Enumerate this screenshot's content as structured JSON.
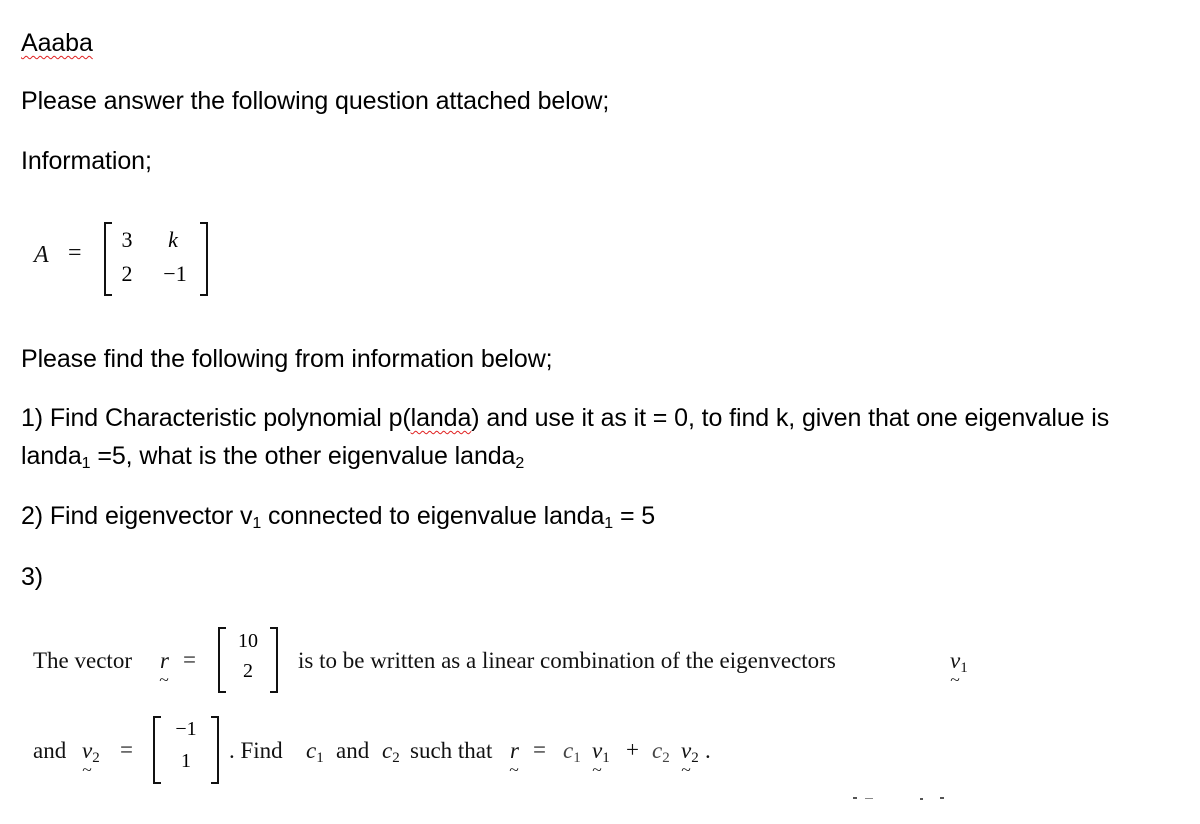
{
  "document": {
    "title": "Aaaba",
    "intro": "Please answer the following question attached below;",
    "information_label": "Information;",
    "matrix_A": {
      "name": "A",
      "equals": "=",
      "rows": [
        [
          "3",
          "k"
        ],
        [
          "2",
          "−1"
        ]
      ]
    },
    "find_label": "Please find the following from information below;",
    "q1": {
      "prefix": "1) Find Characteristic polynomial p(",
      "misspelled": "landa",
      "suffix": ") and use it as it = 0, to find k, given that one eigenvalue is",
      "line2_a": "landa",
      "line2_sub1": "1",
      "line2_b": " =5, what is the other eigenvalue landa",
      "line2_sub2": "2"
    },
    "q2": {
      "a": "2) Find eigenvector v",
      "sub1": "1",
      "b": " connected to eigenvalue landa",
      "sub2": "1",
      "c": " = 5"
    },
    "q3": {
      "label": "3)",
      "line1_a": "The vector",
      "r_symbol": "r",
      "equals": "=",
      "vector_r": [
        "10",
        "2"
      ],
      "line1_b": "is to be written as a linear combination of the eigenvectors",
      "v_symbol": "v",
      "v1_sub": "1",
      "line2_a": "and",
      "v2_sub": "2",
      "vector_v2": [
        "−1",
        "1"
      ],
      "line2_b": ". Find",
      "c_symbol": "c",
      "c1_sub": "1",
      "and": "and",
      "c2_sub": "2",
      "such_that": "such that",
      "plus": "+",
      "period": "."
    }
  }
}
